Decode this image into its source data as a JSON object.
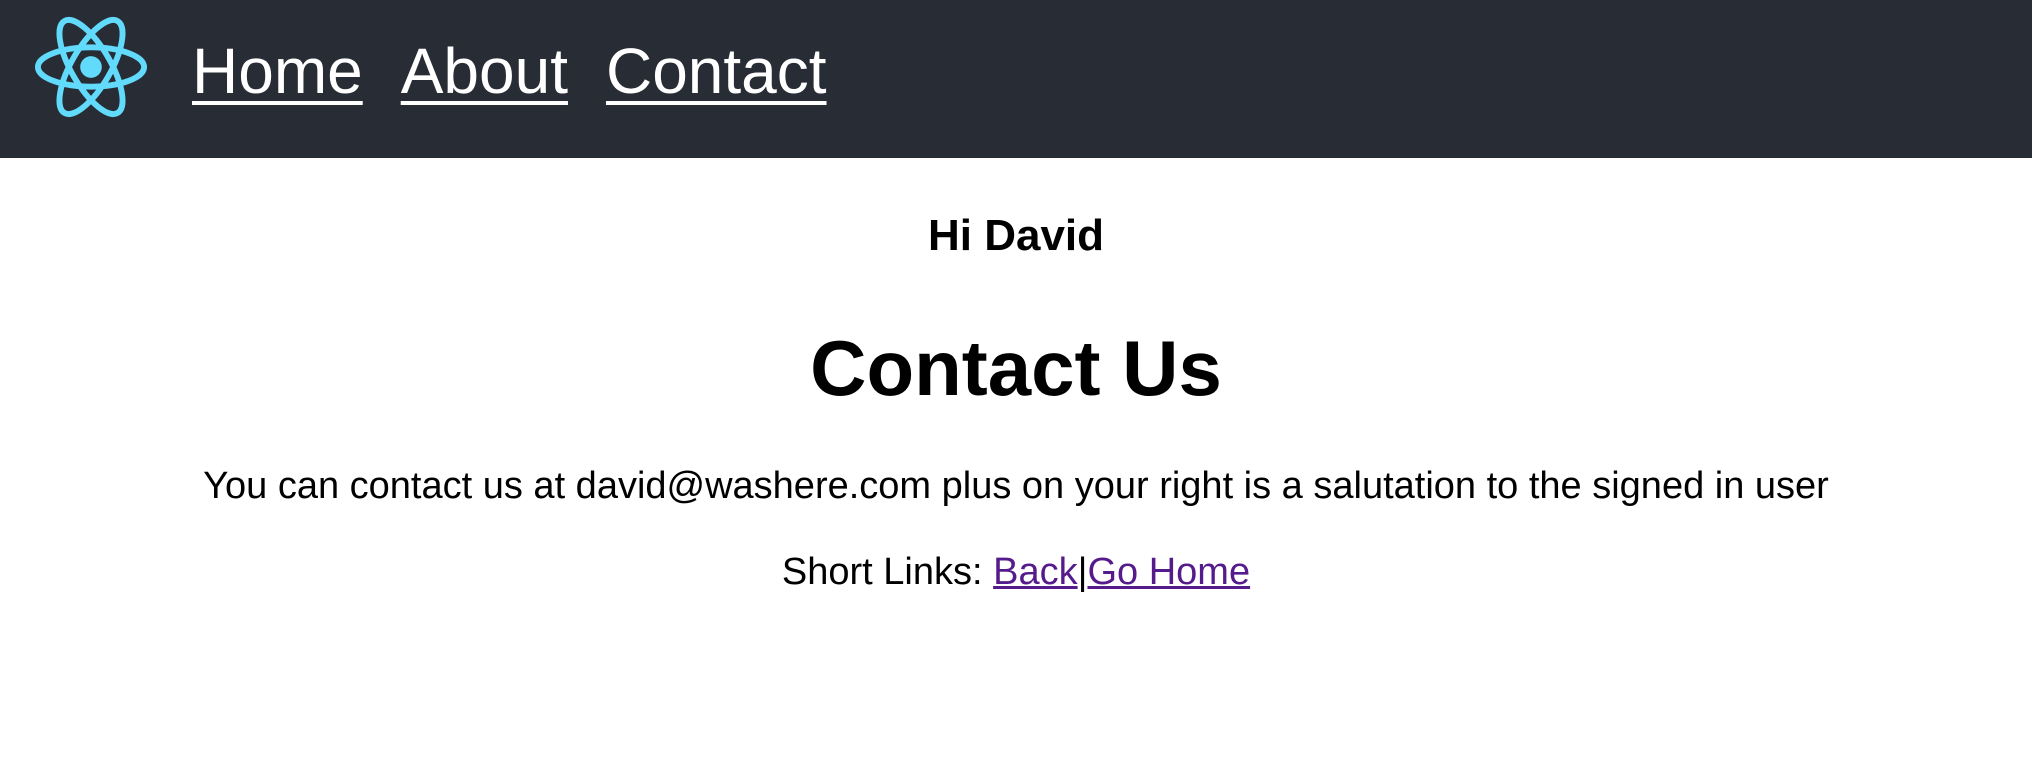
{
  "nav": {
    "logo_icon": "react-atom-logo-icon",
    "logo_color": "#61dafb",
    "links": [
      "Home",
      "About",
      "Contact"
    ]
  },
  "page": {
    "greeting": "Hi David",
    "title": "Contact Us",
    "description": "You can contact us at david@washere.com plus on your right is a salutation to the signed in user",
    "short_links_label": "Short Links:",
    "back_link": "Back",
    "separator": "|",
    "home_link": "Go Home"
  }
}
